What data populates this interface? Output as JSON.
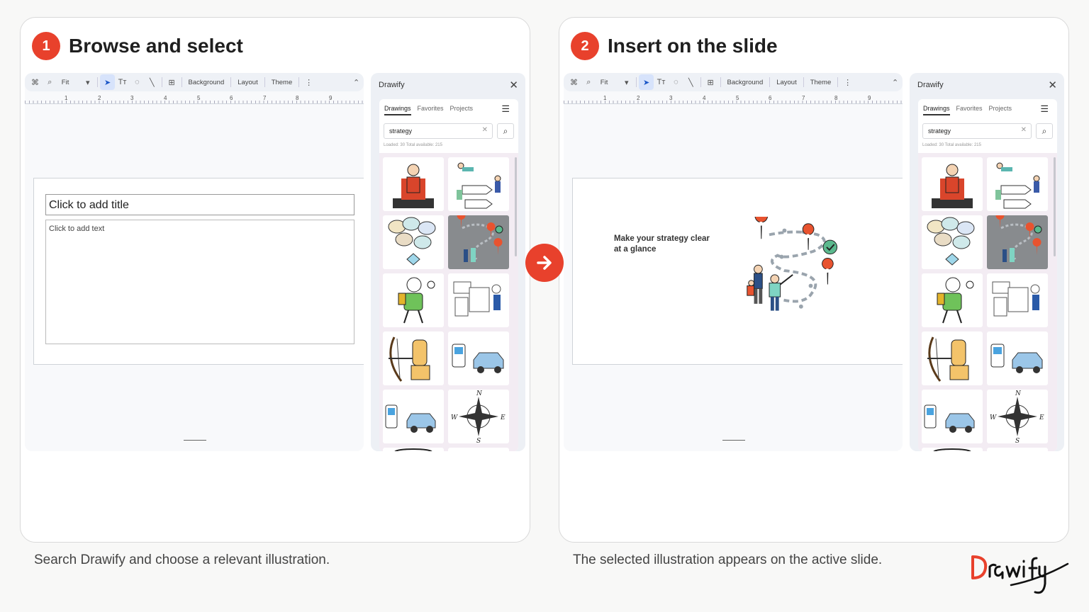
{
  "steps": [
    {
      "number": "1",
      "title": "Browse and select",
      "caption": "Search Drawify and choose a relevant illustration.",
      "slide": {
        "title_placeholder": "Click to add title",
        "body_placeholder": "Click to add text"
      }
    },
    {
      "number": "2",
      "title": "Insert on the slide",
      "caption": "The selected illustration appears on the active slide.",
      "slide": {
        "text": "Make your strategy clear at a glance"
      }
    }
  ],
  "toolbar": {
    "zoom": "Fit",
    "background": "Background",
    "layout": "Layout",
    "theme": "Theme"
  },
  "ruler": {
    "labels": [
      "1",
      "2",
      "3",
      "4",
      "5",
      "6",
      "7",
      "8",
      "9"
    ]
  },
  "panel": {
    "title": "Drawify",
    "tabs": [
      "Drawings",
      "Favorites",
      "Projects"
    ],
    "search_value": "strategy",
    "loaded_text": "Loaded: 30   Total available: 215",
    "icons": [
      "close-icon",
      "menu-icon",
      "search-icon",
      "clear-icon"
    ]
  },
  "colors": {
    "accent": "#e8412c",
    "selected_tile": "#888b8e"
  },
  "logo_text": "Drawify"
}
